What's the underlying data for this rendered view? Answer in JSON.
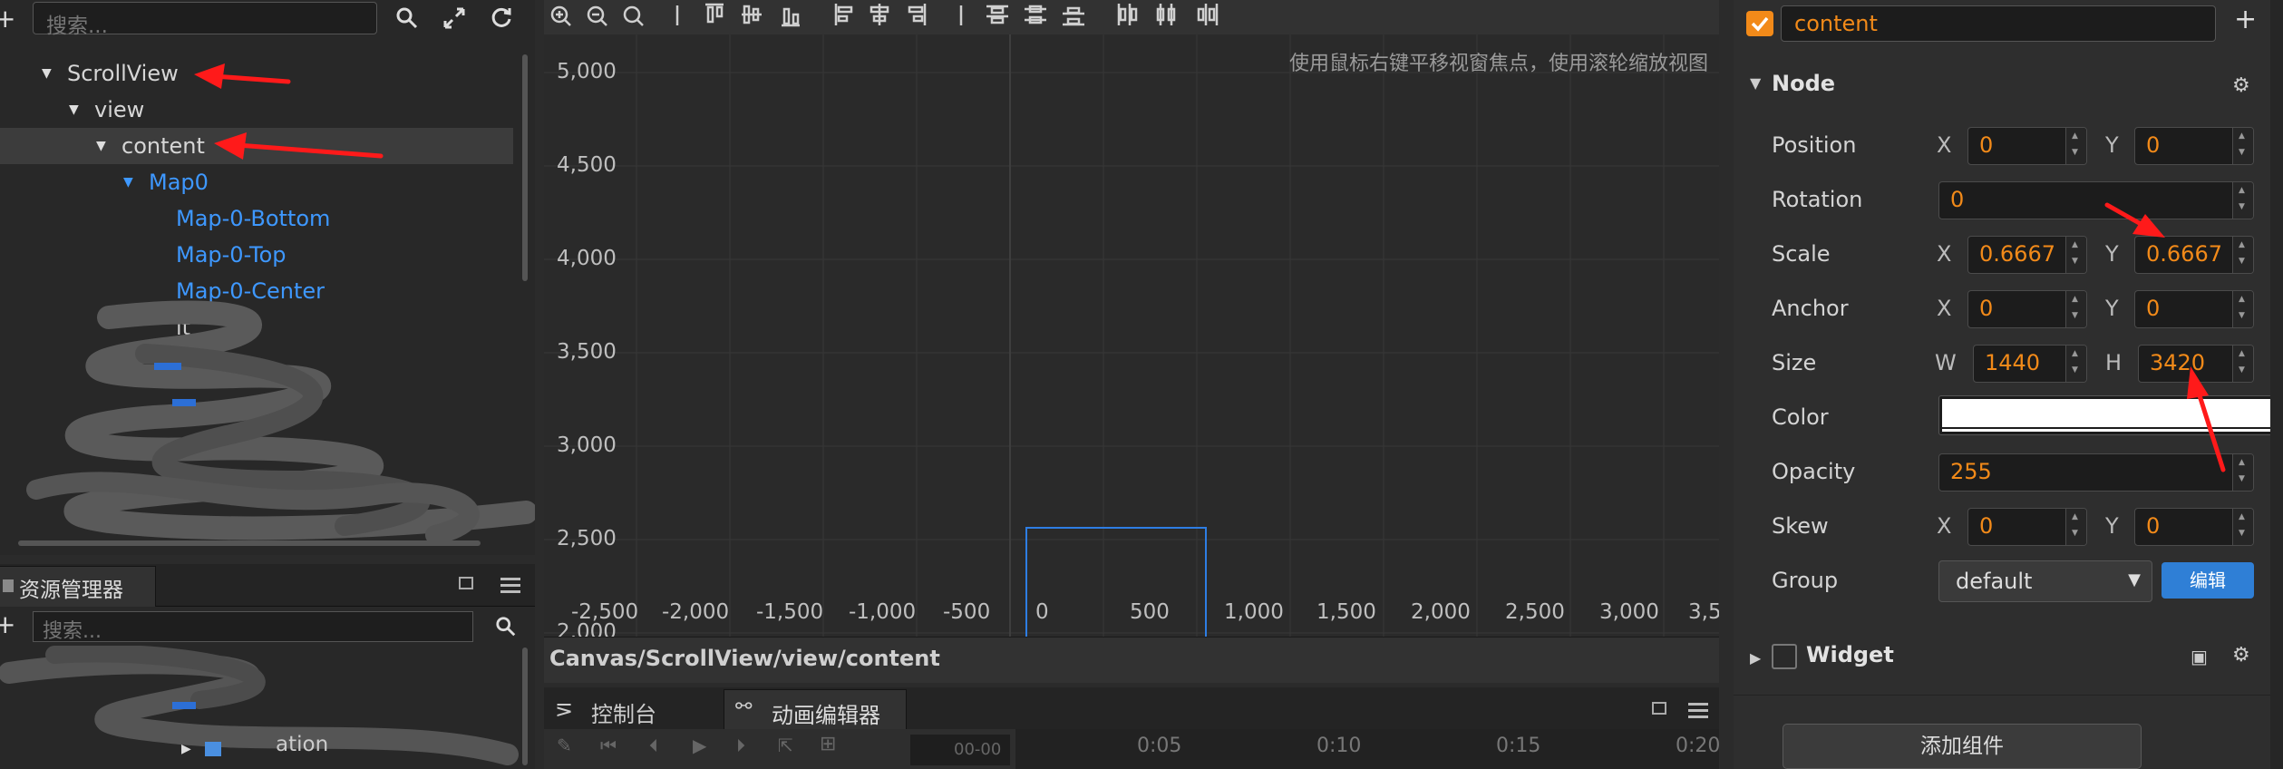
{
  "hierarchy": {
    "search_placeholder": "搜索...",
    "nodes": [
      {
        "label": "ScrollView"
      },
      {
        "label": "view"
      },
      {
        "label": "content"
      },
      {
        "label": "Map0"
      },
      {
        "label": "Map-0-Bottom"
      },
      {
        "label": "Map-0-Top"
      },
      {
        "label": "Map-0-Center"
      },
      {
        "label": "it"
      }
    ]
  },
  "assets": {
    "tab_label": "资源管理器",
    "search_placeholder": "搜索...",
    "partial_item": "ation"
  },
  "scene": {
    "hint": "使用鼠标右键平移视窗焦点，使用滚轮缩放视图",
    "y_ticks": [
      "5,000",
      "4,500",
      "4,000",
      "3,500",
      "3,000",
      "2,500",
      "2,000"
    ],
    "x_ticks": [
      "-2,500",
      "-2,000",
      "-1,500",
      "-1,000",
      "-500",
      "0",
      "500",
      "1,000",
      "1,500",
      "2,000",
      "2,500",
      "3,000",
      "3,5"
    ],
    "breadcrumb": "Canvas/ScrollView/view/content"
  },
  "console": {
    "tab_console": "控制台",
    "tab_animation": "动画编辑器",
    "frame": "00-00",
    "timeline_marks": [
      "0:05",
      "0:10",
      "0:15",
      "0:20"
    ]
  },
  "inspector": {
    "node_name": "content",
    "node_section": "Node",
    "position": {
      "label": "Position",
      "x": "0",
      "y": "0"
    },
    "rotation": {
      "label": "Rotation",
      "value": "0"
    },
    "scale": {
      "label": "Scale",
      "x": "0.6667",
      "y": "0.6667"
    },
    "anchor": {
      "label": "Anchor",
      "x": "0",
      "y": "0"
    },
    "size": {
      "label": "Size",
      "w": "1440",
      "h": "3420"
    },
    "color": {
      "label": "Color",
      "value": "#ffffff"
    },
    "opacity": {
      "label": "Opacity",
      "value": "255"
    },
    "skew": {
      "label": "Skew",
      "x": "0",
      "y": "0"
    },
    "group": {
      "label": "Group",
      "value": "default",
      "edit_label": "编辑"
    },
    "axis_x": "X",
    "axis_y": "Y",
    "axis_w": "W",
    "axis_h": "H",
    "widget_section": "Widget",
    "add_component": "添加组件"
  },
  "colors": {
    "accent_blue": "#3e98ff",
    "value_orange": "#f28a19",
    "annotation_red": "#ff1a1a"
  }
}
